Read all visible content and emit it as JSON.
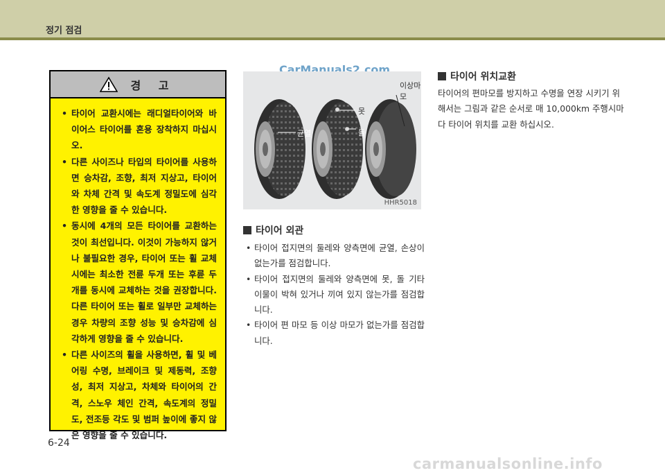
{
  "header": {
    "title": "정기 점검"
  },
  "warning": {
    "title": "경 고",
    "items": [
      "타이어 교환시에는 래디얼타이어와 바이어스 타이어를 혼용 장착하지 마십시오.",
      "다른 사이즈나 타입의 타이어를 사용하면 승차감, 조향, 최저 지상고, 타이어와 차체 간격 및 속도계 정밀도에 심각한 영향을 줄 수 있습니다.",
      "동시에 4개의 모든 타이어를 교환하는 것이 최선입니다. 이것이 가능하지 않거나 불필요한 경우, 타이어 또는 휠 교체 시에는 최소한 전륜 두개 또는 후륜 두 개를 동시에 교체하는 것을 권장합니다. 다른 타이어 또는 휠로 일부만 교체하는 경우 차량의 조향 성능 및 승차감에 심각하게 영향을 줄 수 있습니다.",
      "다른 사이즈의 휠을 사용하면, 휠 및 베어링 수명, 브레이크 및 제동력, 조향성, 최저 지상고, 차체와 타이어의 간격, 스노우 체인 간격, 속도계의 정밀도, 전조등 각도 및 범퍼 높이에 좋지 않은 영향을 줄 수 있습니다."
    ]
  },
  "page_number": "6-24",
  "figure": {
    "labels": {
      "abnormal_wear": "이상마모",
      "nail": "못",
      "crack": "균열",
      "stone": "돌"
    },
    "code": "HHR5018"
  },
  "watermark_top": "CarManuals2.com",
  "tire_appearance": {
    "title": "타이어 외관",
    "items": [
      "타이어 접지면의 둘레와 양측면에 균열, 손상이 없는가를 점검합니다.",
      "타이어 접지면의 둘레와 양측면에 못, 돌 기타 이물이 박혀 있거나 끼여 있지 않는가를 점검합니다.",
      "타이어 편 마모 등 이상 마모가 없는가를 점검합니다."
    ]
  },
  "tire_rotation": {
    "title": "타이어 위치교환",
    "text": "타이어의 편마모를 방지하고 수명을 연장 시키기 위해서는 그림과 같은 순서로 매 10,000km 주행시마다 타이어 위치를 교환 하십시오."
  },
  "footer_watermark": "carmanualsonline.info",
  "colors": {
    "header_bg": "#cfcfa8",
    "header_rule": "#8a8c4a",
    "warning_bg": "#fff200",
    "warning_head_bg": "#bdbdbd"
  }
}
